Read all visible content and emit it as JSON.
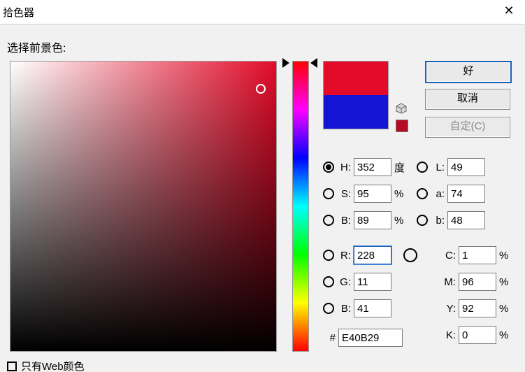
{
  "title": "拾色器",
  "prompt": "选择前景色:",
  "buttons": {
    "ok": "好",
    "cancel": "取消",
    "custom": "自定(C)"
  },
  "hsb": {
    "H_label": "H:",
    "H": "352",
    "H_unit": "度",
    "S_label": "S:",
    "S": "95",
    "S_unit": "%",
    "B_label": "B:",
    "B": "89",
    "B_unit": "%"
  },
  "lab": {
    "L_label": "L:",
    "L": "49",
    "a_label": "a:",
    "a": "74",
    "b_label": "b:",
    "b": "48"
  },
  "rgb": {
    "R_label": "R:",
    "R": "228",
    "G_label": "G:",
    "G": "11",
    "B_label": "B:",
    "B": "41"
  },
  "cmyk": {
    "C_label": "C:",
    "C": "1",
    "unit": "%",
    "M_label": "M:",
    "M": "96",
    "Y_label": "Y:",
    "Y": "92",
    "K_label": "K:",
    "K": "0"
  },
  "hex": {
    "label": "#",
    "value": "E40B29"
  },
  "webonly_label": "只有Web颜色",
  "colors": {
    "new_hex": "#e30b29",
    "current_hex": "#1414d4",
    "gamut_swatch": "#b40a23"
  }
}
